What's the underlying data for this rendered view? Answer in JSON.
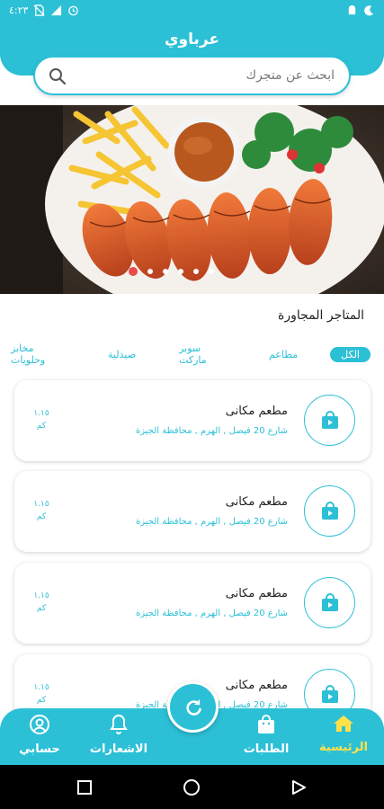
{
  "status_bar": {
    "time": "٤:٢٣"
  },
  "header": {
    "title": "عرباوي"
  },
  "search": {
    "placeholder": "ابحث عن متجرك"
  },
  "banner": {
    "slide_count": 6,
    "active_index": 0
  },
  "section_title": "المتاجر المجاورة",
  "filters": [
    "الكل",
    "مطاعم",
    "سوبر ماركت",
    "صيدلية",
    "مخابز وحلويات"
  ],
  "active_filter": "الكل",
  "stores": [
    {
      "name": "مطعم مكانى",
      "address": "شارع 20 فيصل , الهرم , محافظة الجيزة",
      "distance": "١.١٥",
      "unit": "كم"
    },
    {
      "name": "مطعم مكانى",
      "address": "شارع 20 فيصل , الهرم , محافظة الجيزة",
      "distance": "١.١٥",
      "unit": "كم"
    },
    {
      "name": "مطعم مكانى",
      "address": "شارع 20 فيصل , الهرم , محافظة الجيزة",
      "distance": "١.١٥",
      "unit": "كم"
    },
    {
      "name": "مطعم مكانى",
      "address": "شارع 20 فيصل , الهرم , محافظة الجيزة",
      "distance": "١.١٥",
      "unit": "كم"
    }
  ],
  "bottom_nav": {
    "home": "الرئيسية",
    "orders": "الطلبات",
    "notifications": "الاشعارات",
    "account": "حسابي"
  },
  "colors": {
    "accent": "#2cc0d6",
    "active_nav": "#ffe14a",
    "indicator": "#e94a4a"
  },
  "icons": [
    "moon-icon",
    "android-icon",
    "no-sim-icon",
    "signal-icon",
    "alarm-icon",
    "search-icon",
    "shopping-bag-play-icon",
    "refresh-icon",
    "home-icon",
    "bag-icon",
    "bell-icon",
    "user-circle-icon",
    "square-icon",
    "circle-icon",
    "back-triangle-icon"
  ]
}
